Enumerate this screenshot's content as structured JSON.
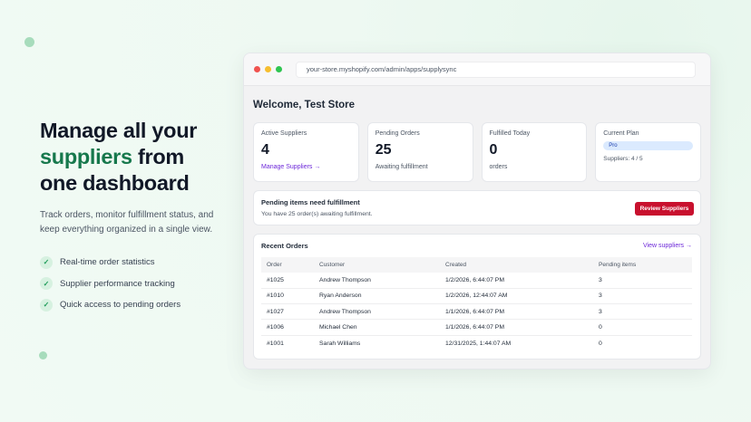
{
  "hero": {
    "headline_line1": "Manage all your",
    "headline_accent": "suppliers",
    "headline_line2_rest": " from",
    "headline_line3": "one dashboard",
    "subtext": "Track orders, monitor fulfillment status, and keep everything organized in a single view.",
    "features": [
      {
        "label": "Real-time order statistics",
        "icon": "check-icon"
      },
      {
        "label": "Supplier performance tracking",
        "icon": "check-icon"
      },
      {
        "label": "Quick access to pending orders",
        "icon": "check-icon"
      }
    ]
  },
  "browser": {
    "url": "your-store.myshopify.com/admin/apps/supplysync"
  },
  "dashboard": {
    "welcome": "Welcome, Test Store",
    "stats": {
      "active_suppliers": {
        "label": "Active Suppliers",
        "value": "4",
        "link": "Manage Suppliers →"
      },
      "pending_orders": {
        "label": "Pending Orders",
        "value": "25",
        "sub": "Awaiting fulfillment"
      },
      "fulfilled_today": {
        "label": "Fulfilled Today",
        "value": "0",
        "sub": "orders"
      },
      "current_plan": {
        "label": "Current Plan",
        "badge": "Pro",
        "sub": "Suppliers: 4 / 5"
      }
    },
    "alert": {
      "title": "Pending items need fulfillment",
      "body": "You have 25 order(s) awaiting fulfillment.",
      "button": "Review Suppliers"
    },
    "orders": {
      "title": "Recent Orders",
      "link": "View suppliers →",
      "columns": [
        "Order",
        "Customer",
        "Created",
        "Pending items"
      ],
      "rows": [
        [
          "#1025",
          "Andrew Thompson",
          "1/2/2026, 6:44:07 PM",
          "3"
        ],
        [
          "#1010",
          "Ryan Anderson",
          "1/2/2026, 12:44:07 AM",
          "3"
        ],
        [
          "#1027",
          "Andrew Thompson",
          "1/1/2026, 6:44:07 PM",
          "3"
        ],
        [
          "#1006",
          "Michael Chen",
          "1/1/2026, 6:44:07 PM",
          "0"
        ],
        [
          "#1001",
          "Sarah Williams",
          "12/31/2025, 1:44:07 AM",
          "0"
        ]
      ]
    }
  },
  "colors": {
    "accent_green": "#16784c",
    "link_purple": "#6d28d9",
    "button_red": "#c8102e",
    "plan_badge_bg": "#dbeafe"
  }
}
